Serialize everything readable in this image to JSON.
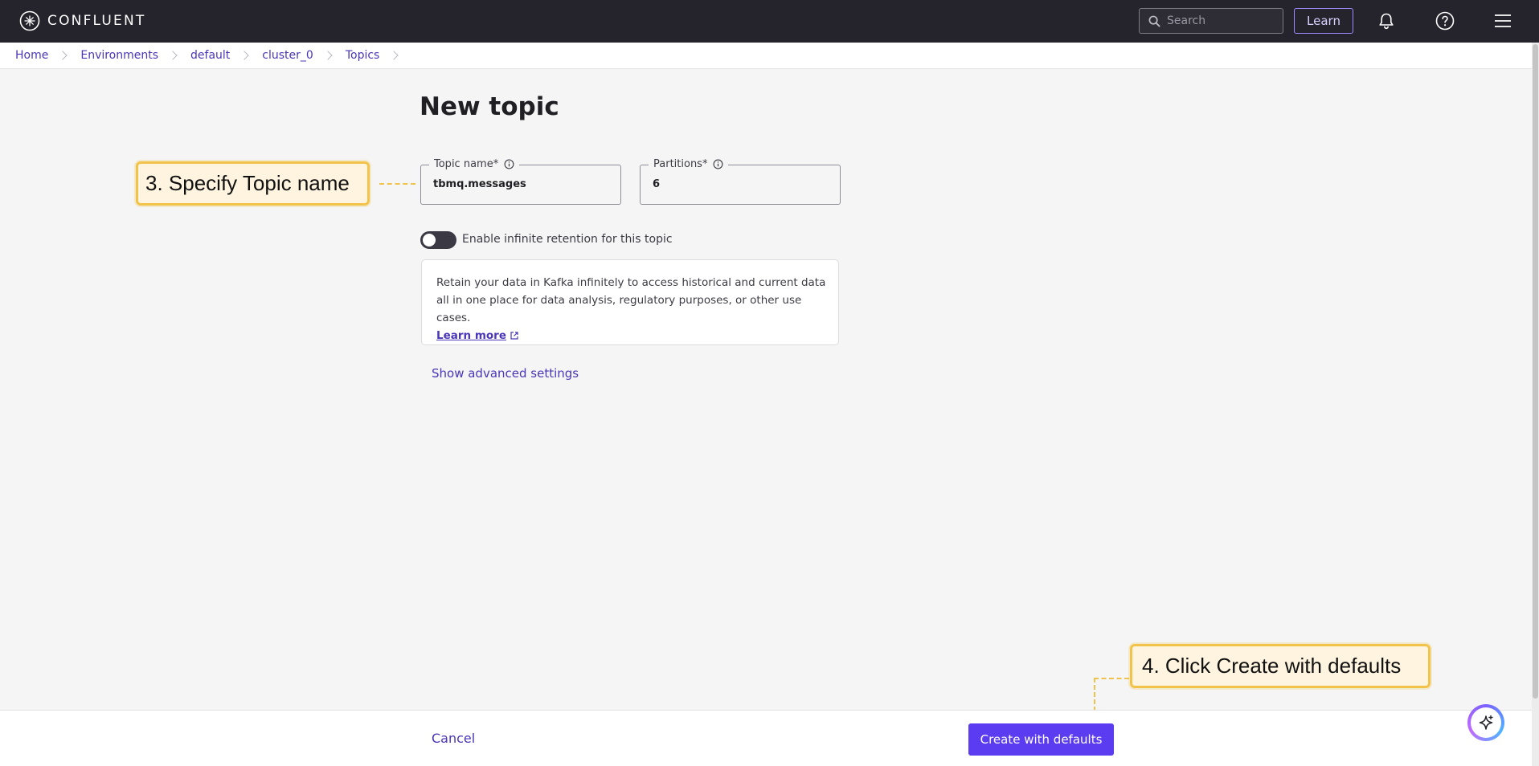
{
  "header": {
    "brand": "CONFLUENT",
    "search_placeholder": "Search",
    "learn_label": "Learn",
    "icons": [
      "confluent-logo-icon",
      "search-icon",
      "bell-icon",
      "help-icon",
      "hamburger-menu-icon"
    ]
  },
  "breadcrumb": {
    "items": [
      "Home",
      "Environments",
      "default",
      "cluster_0",
      "Topics"
    ]
  },
  "page": {
    "title": "New topic"
  },
  "form": {
    "topic_name": {
      "label": "Topic name*",
      "value": "tbmq.messages"
    },
    "partitions": {
      "label": "Partitions*",
      "value": "6"
    },
    "retention_toggle": {
      "label": "Enable infinite retention for this topic",
      "enabled": false
    },
    "info_box": {
      "text": "Retain your data in Kafka infinitely to access historical and current data all in one place for data analysis, regulatory purposes, or other use cases.",
      "link": "Learn more"
    },
    "advanced_link": "Show advanced settings"
  },
  "footer": {
    "cancel_label": "Cancel",
    "create_label": "Create with defaults"
  },
  "annotations": {
    "step3": "3. Specify Topic name",
    "step4": "4. Click Create with defaults"
  },
  "colors": {
    "topbar_bg": "#25232b",
    "accent": "#5b3cf0",
    "link": "#4936b8",
    "callout_bg": "#fff4df",
    "callout_border": "#f2c34a"
  }
}
